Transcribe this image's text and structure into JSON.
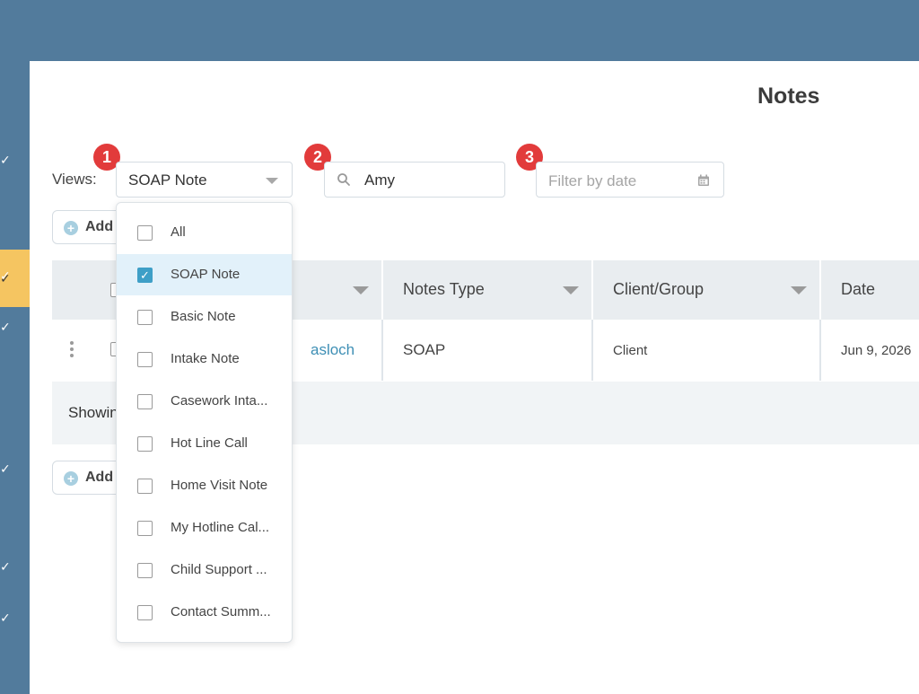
{
  "page": {
    "title": "Notes"
  },
  "sidebar": {
    "check_glyph": "✓",
    "active_index": 1
  },
  "badges": [
    "1",
    "2",
    "3"
  ],
  "filters": {
    "views_label": "Views:",
    "views_selected": "SOAP Note",
    "search_value": "Amy",
    "date_placeholder": "Filter by date"
  },
  "toolbar": {
    "add_label": "Add"
  },
  "dropdown": {
    "items": [
      {
        "label": "All",
        "checked": false
      },
      {
        "label": "SOAP Note",
        "checked": true
      },
      {
        "label": "Basic Note",
        "checked": false
      },
      {
        "label": "Intake Note",
        "checked": false
      },
      {
        "label": "Casework Inta...",
        "checked": false
      },
      {
        "label": "Hot Line Call",
        "checked": false
      },
      {
        "label": "Home Visit Note",
        "checked": false
      },
      {
        "label": "My Hotline Cal...",
        "checked": false
      },
      {
        "label": "Child Support ...",
        "checked": false
      },
      {
        "label": "Contact Summ...",
        "checked": false
      }
    ]
  },
  "table": {
    "columns": [
      "Notes Type",
      "Client/Group",
      "Date"
    ],
    "rows": [
      {
        "name": "asloch",
        "notes_type": "SOAP",
        "client_group": "Client",
        "date": "Jun 9, 2026"
      }
    ],
    "footer": "Showin"
  },
  "colors": {
    "accent": "#3e9fc7",
    "badge": "#e23b3b",
    "sidebar": "#527b9c",
    "active": "#f5c561"
  }
}
